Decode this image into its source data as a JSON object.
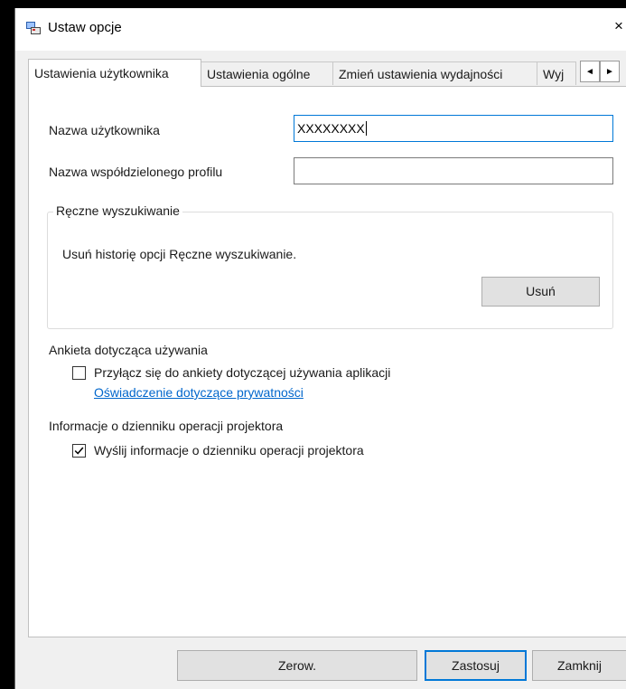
{
  "window": {
    "title": "Ustaw opcje",
    "close_glyph": "×"
  },
  "tabs": [
    {
      "label": "Ustawienia użytkownika",
      "active": true
    },
    {
      "label": "Ustawienia ogólne",
      "active": false
    },
    {
      "label": "Zmień ustawienia wydajności",
      "active": false
    },
    {
      "label": "Wyj",
      "active": false
    }
  ],
  "tab_scroll": {
    "left_glyph": "◄",
    "right_glyph": "►"
  },
  "user": {
    "username_label": "Nazwa użytkownika",
    "username_value": "XXXXXXXX",
    "shared_profile_label": "Nazwa współdzielonego profilu",
    "shared_profile_value": ""
  },
  "manual_search": {
    "group_title": "Ręczne wyszukiwanie",
    "description": "Usuń historię opcji Ręczne wyszukiwanie.",
    "delete_button": "Usuń"
  },
  "survey": {
    "heading": "Ankieta dotycząca używania",
    "checkbox_label": "Przyłącz się do ankiety dotyczącej używania aplikacji",
    "checked": false,
    "privacy_link": "Oświadczenie dotyczące prywatności"
  },
  "projector_log": {
    "heading": "Informacje o dzienniku operacji projektora",
    "checkbox_label": "Wyślij informacje o dzienniku operacji projektora",
    "checked": true
  },
  "footer": {
    "reset_button": "Zerow.",
    "apply_button": "Zastosuj",
    "close_button": "Zamknij"
  },
  "colors": {
    "accent": "#0078d7",
    "link": "#0066cc",
    "dialog_bg": "#f0f0f0",
    "panel_bg": "#ffffff"
  }
}
